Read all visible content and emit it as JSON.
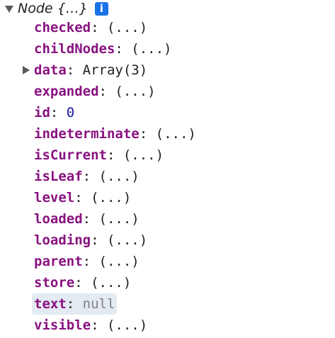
{
  "header": {
    "label": "Node {…}",
    "info_icon": "i"
  },
  "properties": [
    {
      "key": "checked",
      "value": "(...)"
    },
    {
      "key": "childNodes",
      "value": "(...)"
    },
    {
      "key": "data",
      "value": "Array(3)"
    },
    {
      "key": "expanded",
      "value": "(...)"
    },
    {
      "key": "id",
      "value": "0"
    },
    {
      "key": "indeterminate",
      "value": "(...)"
    },
    {
      "key": "isCurrent",
      "value": "(...)"
    },
    {
      "key": "isLeaf",
      "value": "(...)"
    },
    {
      "key": "level",
      "value": "(...)"
    },
    {
      "key": "loaded",
      "value": "(...)"
    },
    {
      "key": "loading",
      "value": "(...)"
    },
    {
      "key": "parent",
      "value": "(...)"
    },
    {
      "key": "store",
      "value": "(...)"
    },
    {
      "key": "text",
      "value": "null"
    },
    {
      "key": "visible",
      "value": "(...)"
    }
  ],
  "separator": ":",
  "colors": {
    "key": "#881280",
    "number": "#1a1aa6",
    "null": "#808080",
    "info_icon_bg": "#1a73e8",
    "highlight_bg": "#e4eaf2"
  }
}
